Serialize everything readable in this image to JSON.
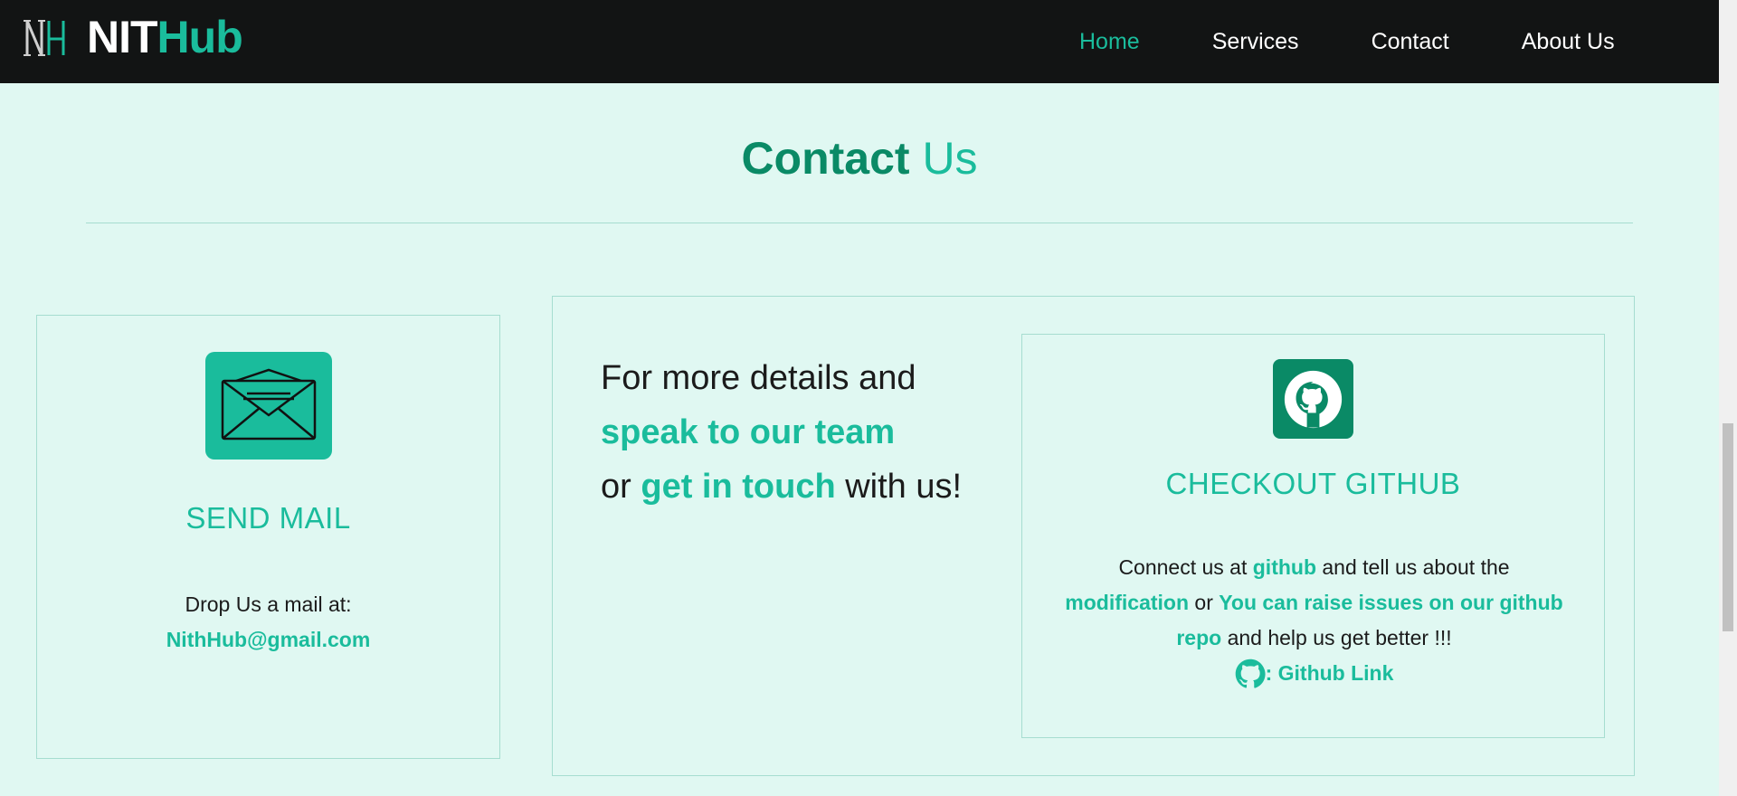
{
  "nav": {
    "brand_part1": "NIT",
    "brand_part2": "Hub",
    "links": [
      {
        "label": "Home",
        "active": true
      },
      {
        "label": "Services",
        "active": false
      },
      {
        "label": "Contact",
        "active": false
      },
      {
        "label": "About Us",
        "active": false
      }
    ]
  },
  "heading": {
    "part1": "Contact",
    "part2": "Us"
  },
  "mail_card": {
    "icon": "envelope-icon",
    "title": "SEND MAIL",
    "text": "Drop Us a mail at:",
    "email": "NithHub@gmail.com"
  },
  "cta": {
    "line1": "For more details and",
    "highlight1": "speak to our team",
    "word_or": "or",
    "highlight2": "get in touch",
    "tail": "with us!"
  },
  "github_card": {
    "icon": "github-icon",
    "title": "CHECKOUT GITHUB",
    "text1": "Connect us at",
    "hl1": "github",
    "text2": "and tell us about the",
    "hl2": "modification",
    "text3": "or",
    "hl3": "You can raise issues on our github repo",
    "text4": "and help us get better !!!",
    "link_label": ": Github Link"
  },
  "colors": {
    "accent": "#1abc9c",
    "accent_dark": "#0a8a66",
    "navbar_bg": "#121414",
    "page_bg": "#e0f8f2"
  }
}
